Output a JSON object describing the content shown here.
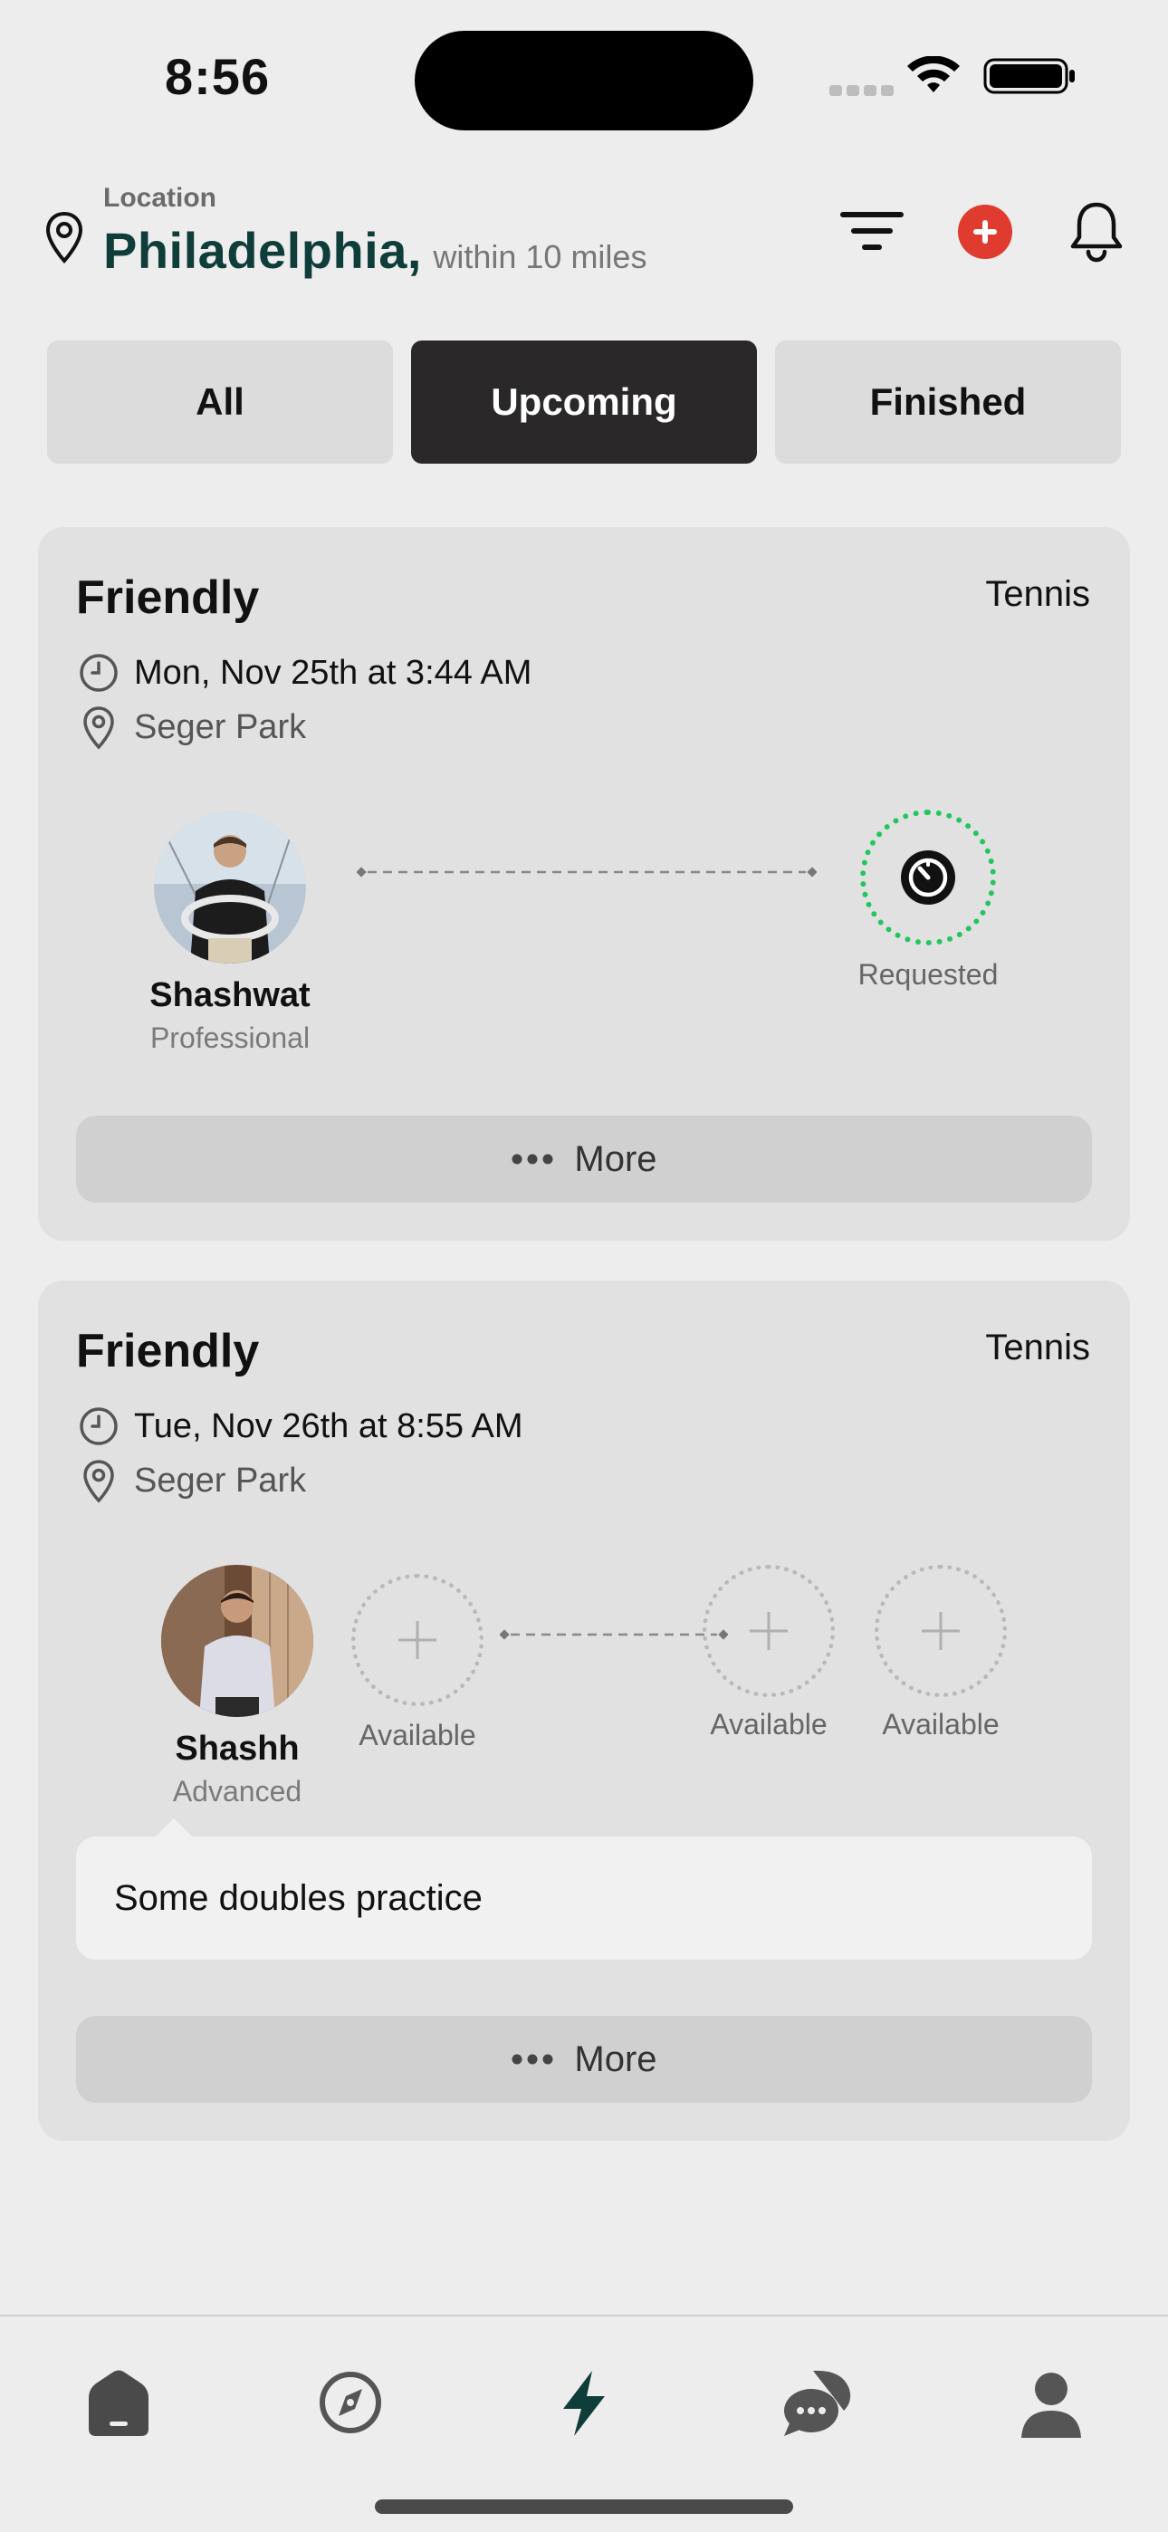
{
  "status_bar": {
    "time": "8:56"
  },
  "header": {
    "location_caption": "Location",
    "city": "Philadelphia,",
    "radius": "within 10 miles"
  },
  "tabs": [
    {
      "label": "All",
      "active": false
    },
    {
      "label": "Upcoming",
      "active": true
    },
    {
      "label": "Finished",
      "active": false
    }
  ],
  "matches": [
    {
      "title": "Friendly",
      "sport": "Tennis",
      "datetime": "Mon, Nov 25th at 3:44 AM",
      "venue": "Seger Park",
      "players": [
        {
          "name": "Shashwat",
          "level": "Professional"
        }
      ],
      "opponent_status": "Requested",
      "more_label": "More"
    },
    {
      "title": "Friendly",
      "sport": "Tennis",
      "datetime": "Tue, Nov 26th at 8:55 AM",
      "venue": "Seger Park",
      "players": [
        {
          "name": "Shashh",
          "level": "Advanced"
        }
      ],
      "open_slots": [
        "Available",
        "Available",
        "Available"
      ],
      "note": "Some doubles practice",
      "more_label": "More"
    }
  ],
  "colors": {
    "brand_dark_teal": "#0f3d3a",
    "accent_red": "#e03b2f",
    "requested_green": "#22c55e",
    "active_tab": "#2a2828"
  },
  "nav": [
    {
      "icon": "home-icon"
    },
    {
      "icon": "compass-icon"
    },
    {
      "icon": "bolt-icon",
      "active": true
    },
    {
      "icon": "chat-icon"
    },
    {
      "icon": "profile-icon"
    }
  ]
}
